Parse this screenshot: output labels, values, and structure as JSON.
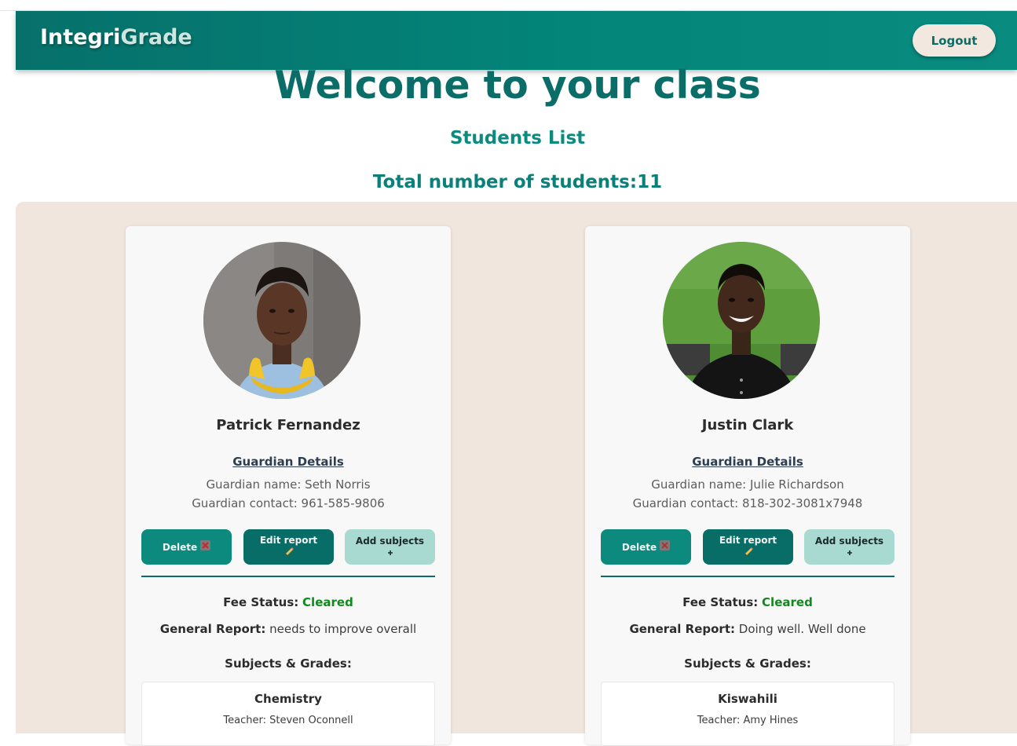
{
  "navbar": {
    "brand_part1": "Integri",
    "brand_part2": "Grade",
    "logout_label": "Logout"
  },
  "main": {
    "heading": "Welcome to your class",
    "subheading": "Students List",
    "total_label": "Total number of students:11"
  },
  "labels": {
    "guardian_details": "Guardian Details",
    "delete": "Delete",
    "edit_report": "Edit report",
    "add_subjects": "Add subjects",
    "fee_status": "Fee Status:",
    "general_report": "General Report:",
    "subjects_grades": "Subjects & Grades:"
  },
  "students": [
    {
      "name": "Patrick Fernandez",
      "guardian_name": "Guardian name: Seth Norris",
      "guardian_contact": "Guardian contact: 961-585-9806",
      "fee_status": "Cleared",
      "general_report": "needs to improve overall",
      "subjects": [
        {
          "name": "Chemistry",
          "teacher": "Teacher: Steven Oconnell"
        }
      ]
    },
    {
      "name": "Justin Clark",
      "guardian_name": "Guardian name: Julie Richardson",
      "guardian_contact": "Guardian contact: 818-302-3081x7948",
      "fee_status": "Cleared",
      "general_report": "Doing well. Well done",
      "subjects": [
        {
          "name": "Kiswahili",
          "teacher": "Teacher: Amy Hines"
        }
      ]
    }
  ],
  "icons": {
    "delete": "cross-mark-icon",
    "edit": "pencil-icon",
    "add": "plus-icon"
  },
  "colors": {
    "primary": "#07706b",
    "accent": "#0b8a80",
    "panel_bg": "#f0e6de",
    "cleared": "#108a1c"
  }
}
